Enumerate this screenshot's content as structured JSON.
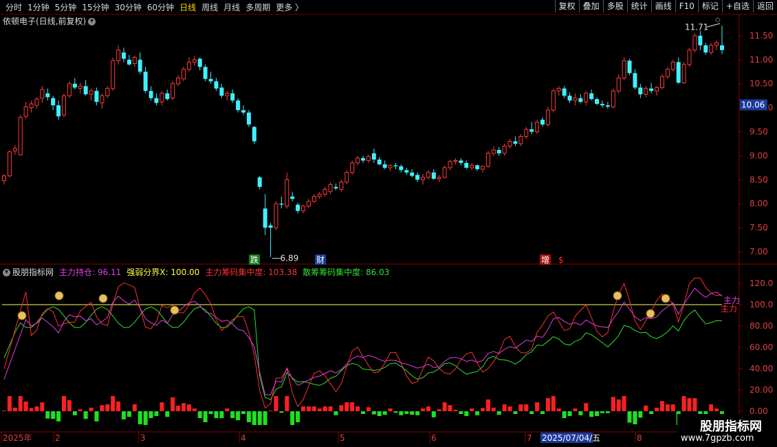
{
  "toolbar": {
    "periods": [
      "分时",
      "1分钟",
      "5分钟",
      "15分钟",
      "30分钟",
      "60分钟",
      "日线",
      "周线",
      "月线",
      "多周期",
      "更多 〉"
    ],
    "active": "日线",
    "actions": [
      "复权",
      "叠加",
      "多股",
      "统计",
      "画线",
      "F10",
      "标记",
      "+自选",
      "返回"
    ]
  },
  "stock_title": "依顿电子(日线,前复权)",
  "price_axis": [
    "11.50",
    "11.00",
    "10.50",
    "10.00",
    "9.50",
    "9.00",
    "8.50",
    "8.00",
    "7.50",
    "7.00"
  ],
  "current_price": "10.06",
  "high_label": "11.71",
  "low_label": "6.89",
  "event_markers": [
    "跌",
    "财",
    "增",
    "$"
  ],
  "indicator": {
    "name": "股朋指标网",
    "items": [
      {
        "label": "主力持仓: 96.11",
        "color": "#e040e0"
      },
      {
        "label": "强弱分界X: 100.00",
        "color": "#ffff40"
      },
      {
        "label": "主力筹码集中度: 103.38",
        "color": "#ff3030"
      },
      {
        "label": "散筹筹码集中度: 86.03",
        "color": "#30e030"
      }
    ],
    "axis": [
      "120.0",
      "100.0",
      "80.00",
      "60.00",
      "40.00",
      "20.00",
      "0.00"
    ],
    "side_labels": [
      "主力",
      "主力"
    ]
  },
  "date_axis": [
    "2025年",
    "2",
    "3",
    "4",
    "5",
    "6",
    "7",
    "2025/07/04/五",
    "8"
  ],
  "watermark": {
    "line1": "股朋指标网",
    "line2": "www.7gpzb.com"
  },
  "colors": {
    "up": "#ff3b3b",
    "down": "#3ff0ff",
    "bg": "#000000",
    "axis": "#8b0000"
  },
  "chart_data": {
    "type": "candlestick",
    "ylim": [
      6.8,
      11.9
    ],
    "candles": [
      [
        8.48,
        8.62,
        8.4,
        8.58
      ],
      [
        8.58,
        9.12,
        8.55,
        9.08
      ],
      [
        9.1,
        9.22,
        9.02,
        9.15
      ],
      [
        9.02,
        9.85,
        9.0,
        9.8
      ],
      [
        9.82,
        10.12,
        9.76,
        10.02
      ],
      [
        10.0,
        10.15,
        9.9,
        10.08
      ],
      [
        10.05,
        10.22,
        9.98,
        10.18
      ],
      [
        10.2,
        10.45,
        10.1,
        10.38
      ],
      [
        10.3,
        10.4,
        10.15,
        10.22
      ],
      [
        10.2,
        10.25,
        9.95,
        10.05
      ],
      [
        10.05,
        10.15,
        9.75,
        9.82
      ],
      [
        9.85,
        10.3,
        9.8,
        10.25
      ],
      [
        10.25,
        10.55,
        10.2,
        10.5
      ],
      [
        10.5,
        10.62,
        10.38,
        10.42
      ],
      [
        10.4,
        10.52,
        10.3,
        10.45
      ],
      [
        10.45,
        10.58,
        10.25,
        10.28
      ],
      [
        10.28,
        10.4,
        10.15,
        10.35
      ],
      [
        10.35,
        10.42,
        10.05,
        10.12
      ],
      [
        10.1,
        10.3,
        9.98,
        10.25
      ],
      [
        10.25,
        10.45,
        10.2,
        10.4
      ],
      [
        10.4,
        11.05,
        10.35,
        10.98
      ],
      [
        10.98,
        11.3,
        10.9,
        11.2
      ],
      [
        11.15,
        11.25,
        10.95,
        11.02
      ],
      [
        11.0,
        11.1,
        10.88,
        10.9
      ],
      [
        10.92,
        11.08,
        10.85,
        11.05
      ],
      [
        11.0,
        11.15,
        10.7,
        10.75
      ],
      [
        10.75,
        10.85,
        10.3,
        10.35
      ],
      [
        10.35,
        10.45,
        10.15,
        10.2
      ],
      [
        10.2,
        10.3,
        10.05,
        10.1
      ],
      [
        10.12,
        10.35,
        10.05,
        10.3
      ],
      [
        10.3,
        10.38,
        10.15,
        10.18
      ],
      [
        10.2,
        10.55,
        10.15,
        10.5
      ],
      [
        10.5,
        10.68,
        10.45,
        10.62
      ],
      [
        10.6,
        10.85,
        10.55,
        10.8
      ],
      [
        10.8,
        11.05,
        10.75,
        10.95
      ],
      [
        10.95,
        11.08,
        10.88,
        11.0
      ],
      [
        11.02,
        11.05,
        10.78,
        10.85
      ],
      [
        10.85,
        10.9,
        10.55,
        10.6
      ],
      [
        10.6,
        10.75,
        10.5,
        10.55
      ],
      [
        10.55,
        10.62,
        10.35,
        10.4
      ],
      [
        10.42,
        10.5,
        10.2,
        10.25
      ],
      [
        10.25,
        10.35,
        10.15,
        10.3
      ],
      [
        10.3,
        10.38,
        10.1,
        10.15
      ],
      [
        10.15,
        10.2,
        9.9,
        9.95
      ],
      [
        9.95,
        10.05,
        9.85,
        9.9
      ],
      [
        9.9,
        9.95,
        9.6,
        9.65
      ],
      [
        9.6,
        9.62,
        9.25,
        9.3
      ],
      [
        8.55,
        8.58,
        8.3,
        8.35
      ],
      [
        7.9,
        8.2,
        7.35,
        7.5
      ],
      [
        7.55,
        7.6,
        6.89,
        7.5
      ],
      [
        7.5,
        8.05,
        7.45,
        8.0
      ],
      [
        8.0,
        8.15,
        7.9,
        7.98
      ],
      [
        7.95,
        8.65,
        7.9,
        8.5
      ],
      [
        8.15,
        8.25,
        8.05,
        8.1
      ],
      [
        7.98,
        8.02,
        7.8,
        7.85
      ],
      [
        7.85,
        7.98,
        7.8,
        7.95
      ],
      [
        7.95,
        8.1,
        7.9,
        8.05
      ],
      [
        8.05,
        8.2,
        8.02,
        8.15
      ],
      [
        8.15,
        8.25,
        8.1,
        8.2
      ],
      [
        8.2,
        8.35,
        8.15,
        8.3
      ],
      [
        8.25,
        8.45,
        8.2,
        8.4
      ],
      [
        8.35,
        8.42,
        8.28,
        8.32
      ],
      [
        8.3,
        8.5,
        8.25,
        8.45
      ],
      [
        8.45,
        8.7,
        8.4,
        8.65
      ],
      [
        8.65,
        8.9,
        8.6,
        8.85
      ],
      [
        8.85,
        9.0,
        8.8,
        8.95
      ],
      [
        8.95,
        9.0,
        8.85,
        8.9
      ],
      [
        8.9,
        9.02,
        8.85,
        8.98
      ],
      [
        9.05,
        9.15,
        8.85,
        8.92
      ],
      [
        8.92,
        8.98,
        8.8,
        8.82
      ],
      [
        8.82,
        8.9,
        8.72,
        8.75
      ],
      [
        8.75,
        8.82,
        8.68,
        8.8
      ],
      [
        8.8,
        8.85,
        8.72,
        8.78
      ],
      [
        8.78,
        8.82,
        8.65,
        8.7
      ],
      [
        8.7,
        8.75,
        8.6,
        8.65
      ],
      [
        8.65,
        8.72,
        8.55,
        8.58
      ],
      [
        8.6,
        8.65,
        8.45,
        8.5
      ],
      [
        8.5,
        8.62,
        8.4,
        8.55
      ],
      [
        8.55,
        8.7,
        8.5,
        8.65
      ],
      [
        8.65,
        8.72,
        8.5,
        8.52
      ],
      [
        8.52,
        8.6,
        8.45,
        8.55
      ],
      [
        8.55,
        8.8,
        8.52,
        8.75
      ],
      [
        8.75,
        8.92,
        8.7,
        8.88
      ],
      [
        8.88,
        8.95,
        8.82,
        8.9
      ],
      [
        8.9,
        8.95,
        8.8,
        8.85
      ],
      [
        8.85,
        8.9,
        8.72,
        8.75
      ],
      [
        8.75,
        8.85,
        8.7,
        8.8
      ],
      [
        8.8,
        8.82,
        8.68,
        8.72
      ],
      [
        8.72,
        8.8,
        8.65,
        8.78
      ],
      [
        8.78,
        9.1,
        8.75,
        9.05
      ],
      [
        9.05,
        9.2,
        9.0,
        9.12
      ],
      [
        9.12,
        9.18,
        9.0,
        9.05
      ],
      [
        9.05,
        9.25,
        9.0,
        9.2
      ],
      [
        9.2,
        9.35,
        9.15,
        9.3
      ],
      [
        9.3,
        9.4,
        9.2,
        9.25
      ],
      [
        9.25,
        9.45,
        9.2,
        9.4
      ],
      [
        9.4,
        9.6,
        9.35,
        9.55
      ],
      [
        9.55,
        9.7,
        9.45,
        9.5
      ],
      [
        9.5,
        9.75,
        9.45,
        9.7
      ],
      [
        9.75,
        9.8,
        9.6,
        9.65
      ],
      [
        9.65,
        10.02,
        9.6,
        9.95
      ],
      [
        9.95,
        10.4,
        9.9,
        10.35
      ],
      [
        10.35,
        10.45,
        10.25,
        10.4
      ],
      [
        10.4,
        10.45,
        10.2,
        10.25
      ],
      [
        10.25,
        10.32,
        10.1,
        10.15
      ],
      [
        10.15,
        10.3,
        10.05,
        10.2
      ],
      [
        10.2,
        10.28,
        10.1,
        10.12
      ],
      [
        10.12,
        10.35,
        10.05,
        10.3
      ],
      [
        10.3,
        10.38,
        10.15,
        10.18
      ],
      [
        10.18,
        10.22,
        10.05,
        10.08
      ],
      [
        10.08,
        10.15,
        10.0,
        10.05
      ],
      [
        10.05,
        10.12,
        9.98,
        10.02
      ],
      [
        10.02,
        10.4,
        9.98,
        10.35
      ],
      [
        10.35,
        10.7,
        10.3,
        10.62
      ],
      [
        10.62,
        11.05,
        10.58,
        10.98
      ],
      [
        10.98,
        11.02,
        10.68,
        10.72
      ],
      [
        10.72,
        10.8,
        10.38,
        10.42
      ],
      [
        10.42,
        10.5,
        10.2,
        10.28
      ],
      [
        10.28,
        10.45,
        10.22,
        10.4
      ],
      [
        10.4,
        10.52,
        10.3,
        10.35
      ],
      [
        10.35,
        10.45,
        10.25,
        10.42
      ],
      [
        10.42,
        10.7,
        10.38,
        10.65
      ],
      [
        10.65,
        10.85,
        10.6,
        10.8
      ],
      [
        10.8,
        11.0,
        10.75,
        10.95
      ],
      [
        10.95,
        11.05,
        10.5,
        10.52
      ],
      [
        10.52,
        10.95,
        10.5,
        10.9
      ],
      [
        10.9,
        11.25,
        10.85,
        11.2
      ],
      [
        11.2,
        11.55,
        11.15,
        11.5
      ],
      [
        11.5,
        11.6,
        11.2,
        11.3
      ],
      [
        11.3,
        11.35,
        11.1,
        11.15
      ],
      [
        11.15,
        11.35,
        11.1,
        11.3
      ],
      [
        11.3,
        11.4,
        11.2,
        11.35
      ],
      [
        11.3,
        11.71,
        11.12,
        11.2
      ]
    ]
  }
}
